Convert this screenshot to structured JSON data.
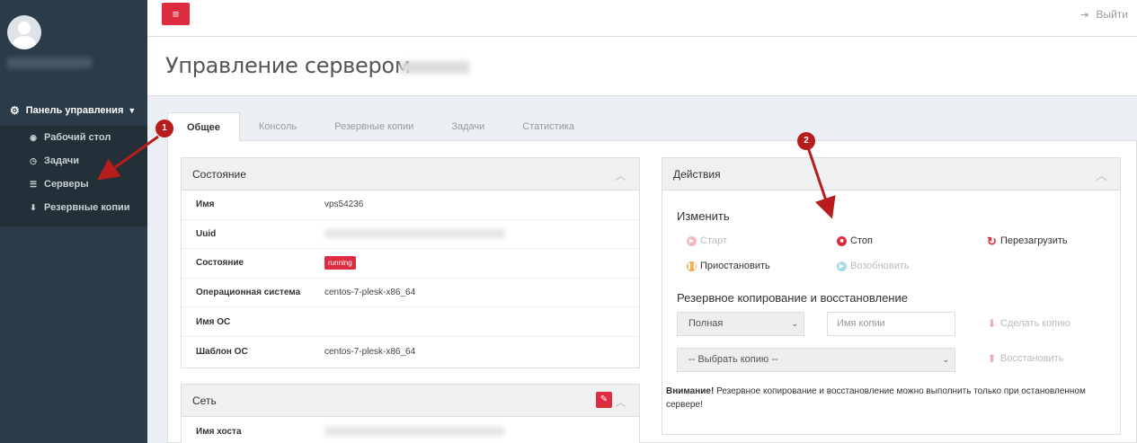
{
  "sidebar": {
    "nav_header": "Панель управления",
    "items": [
      {
        "label": "Рабочий стол",
        "icon": "dashboard-icon"
      },
      {
        "label": "Задачи",
        "icon": "clock-icon"
      },
      {
        "label": "Серверы",
        "icon": "list-icon"
      },
      {
        "label": "Резервные копии",
        "icon": "download-icon"
      }
    ]
  },
  "topbar": {
    "logout_label": "Выйти"
  },
  "page": {
    "title": "Управление сервером"
  },
  "tabs": [
    "Общее",
    "Консоль",
    "Резервные копии",
    "Задачи",
    "Статистика"
  ],
  "state_box": {
    "title": "Состояние",
    "rows": [
      {
        "key": "Имя",
        "value": "vps54236"
      },
      {
        "key": "Uuid",
        "value": ""
      },
      {
        "key": "Состояние",
        "value": "running"
      },
      {
        "key": "Операционная система",
        "value": "centos-7-plesk-x86_64"
      },
      {
        "key": "Имя ОС",
        "value": ""
      },
      {
        "key": "Шаблон ОС",
        "value": "centos-7-plesk-x86_64"
      }
    ]
  },
  "net_box": {
    "title": "Сеть",
    "rows": [
      {
        "key": "Имя хоста",
        "value": ""
      }
    ]
  },
  "actions_box": {
    "title": "Действия",
    "change_title": "Изменить",
    "start": "Старт",
    "stop": "Стоп",
    "restart": "Перезагрузить",
    "pause": "Приостановить",
    "resume": "Возобновить",
    "backup_title": "Резервное копирование и восстановление",
    "backup_type": "Полная",
    "copy_name_placeholder": "Имя копии",
    "make_copy": "Сделать копию",
    "choose_copy": "-- Выбрать копию --",
    "restore": "Восстановить",
    "warning_bold": "Внимание!",
    "warning_text": " Резервное копирование и восстановление можно выполнить только при остановленном сервере!"
  },
  "annotations": {
    "marker1": "1",
    "marker2": "2"
  },
  "colors": {
    "accent": "#dd2c3f",
    "sidebar": "#2c3b48",
    "arrow": "#b81d1d"
  }
}
